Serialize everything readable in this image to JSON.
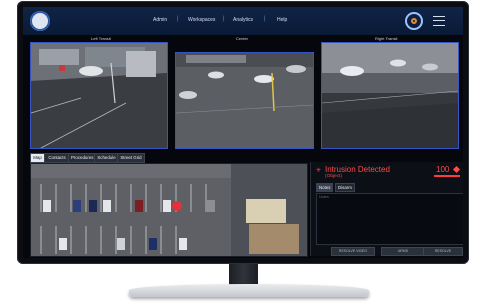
{
  "topbar": {
    "nav": [
      "Admin",
      "Workspaces",
      "Analytics",
      "Help"
    ],
    "separator": "|"
  },
  "cameras": {
    "left_label": "Left Transit",
    "center_label": "Center",
    "right_label": "Right Transit"
  },
  "tabs": [
    "Map",
    "Contacts",
    "Procedures",
    "Schedule",
    "Street Grid"
  ],
  "alert": {
    "title": "Intrusion Detected",
    "subtitle": "(Object)",
    "score": "100",
    "note_tabs": [
      "Notes",
      "Disarm"
    ],
    "notes_placeholder": "Notes",
    "buttons": [
      "RESOLVE VIDEO",
      "ARMS",
      "RESOLVE"
    ]
  },
  "colors": {
    "accent_red": "#ff4b4b",
    "nav_bg": "#0f2447",
    "camera_border": "#3555c5"
  },
  "icons": [
    "logo-icon",
    "eye-logo-icon",
    "menu-icon",
    "alert-icon",
    "priority-diamond-icon"
  ]
}
